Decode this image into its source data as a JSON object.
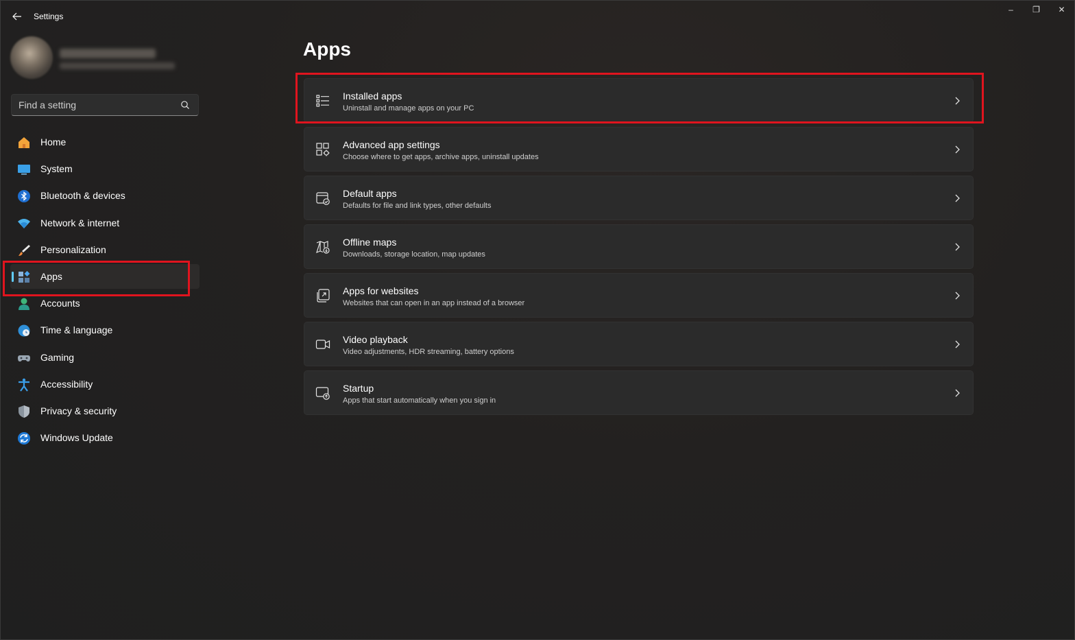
{
  "window": {
    "title": "Settings"
  },
  "window_controls": {
    "minimize": "–",
    "maximize": "❐",
    "close": "✕"
  },
  "search": {
    "placeholder": "Find a setting"
  },
  "sidebar": {
    "items": [
      {
        "label": "Home",
        "icon": "home-icon"
      },
      {
        "label": "System",
        "icon": "system-icon"
      },
      {
        "label": "Bluetooth & devices",
        "icon": "bluetooth-icon"
      },
      {
        "label": "Network & internet",
        "icon": "wifi-icon"
      },
      {
        "label": "Personalization",
        "icon": "brush-icon"
      },
      {
        "label": "Apps",
        "icon": "apps-icon",
        "selected": true
      },
      {
        "label": "Accounts",
        "icon": "person-icon"
      },
      {
        "label": "Time & language",
        "icon": "globe-clock-icon"
      },
      {
        "label": "Gaming",
        "icon": "gamepad-icon"
      },
      {
        "label": "Accessibility",
        "icon": "accessibility-icon"
      },
      {
        "label": "Privacy & security",
        "icon": "shield-icon"
      },
      {
        "label": "Windows Update",
        "icon": "update-icon"
      }
    ]
  },
  "main": {
    "title": "Apps",
    "cards": [
      {
        "title": "Installed apps",
        "description": "Uninstall and manage apps on your PC",
        "icon": "list-icon"
      },
      {
        "title": "Advanced app settings",
        "description": "Choose where to get apps, archive apps, uninstall updates",
        "icon": "app-settings-icon"
      },
      {
        "title": "Default apps",
        "description": "Defaults for file and link types, other defaults",
        "icon": "default-apps-icon"
      },
      {
        "title": "Offline maps",
        "description": "Downloads, storage location, map updates",
        "icon": "map-icon"
      },
      {
        "title": "Apps for websites",
        "description": "Websites that can open in an app instead of a browser",
        "icon": "open-in-app-icon"
      },
      {
        "title": "Video playback",
        "description": "Video adjustments, HDR streaming, battery options",
        "icon": "video-icon"
      },
      {
        "title": "Startup",
        "description": "Apps that start automatically when you sign in",
        "icon": "startup-icon"
      }
    ]
  },
  "colors": {
    "accent": "#60cdff",
    "highlight": "#e0141e",
    "card_bg": "#2b2b2b",
    "window_bg": "#1f1f1f"
  }
}
